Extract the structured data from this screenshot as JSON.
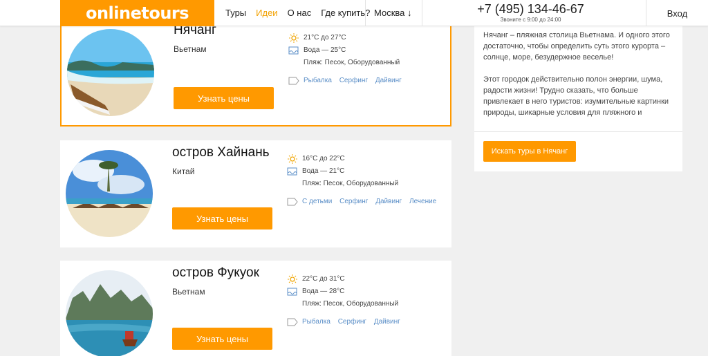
{
  "header": {
    "logo": "onlinetours",
    "nav": [
      "Туры",
      "Идеи",
      "О нас",
      "Где купить?"
    ],
    "city": "Москва ↓",
    "phone": "+7 (495) 134-46-67",
    "hours": "Звоните с 9:00 до 24:00",
    "login": "Вход"
  },
  "cards": [
    {
      "name": "Нячанг",
      "country": "Вьетнам",
      "temp": "21°C до 27°C",
      "water": "Вода — 25°C",
      "beach": "Пляж: Песок, Оборудованный",
      "tags": [
        "Рыбалка",
        "Серфинг",
        "Дайвинг"
      ],
      "button": "Узнать цены"
    },
    {
      "name": "остров Хайнань",
      "country": "Китай",
      "temp": "16°C до 22°C",
      "water": "Вода — 21°C",
      "beach": "Пляж: Песок, Оборудованный",
      "tags": [
        "С детьми",
        "Серфинг",
        "Дайвинг",
        "Лечение"
      ],
      "button": "Узнать цены"
    },
    {
      "name": "остров Фукуок",
      "country": "Вьетнам",
      "temp": "22°C до 31°C",
      "water": "Вода — 28°C",
      "beach": "Пляж: Песок, Оборудованный",
      "tags": [
        "Рыбалка",
        "Серфинг",
        "Дайвинг"
      ],
      "button": "Узнать цены"
    }
  ],
  "panel": {
    "paragraph1": "Нячанг – пляжная столица Вьетнама. И одного этого достаточно, чтобы определить суть этого курорта – солнце, море, безудержное веселье!",
    "paragraph2": "Этот городок действительно полон энергии, шума, радости жизни! Трудно сказать, что больше привлекает в него туристов: изумительные картинки природы, шикарные условия для пляжного и",
    "button": "Искать туры в Нячанг"
  },
  "colors": {
    "accent": "#ff9900",
    "active_nav": "#f2a100",
    "tag_link": "#5a8ec7"
  }
}
